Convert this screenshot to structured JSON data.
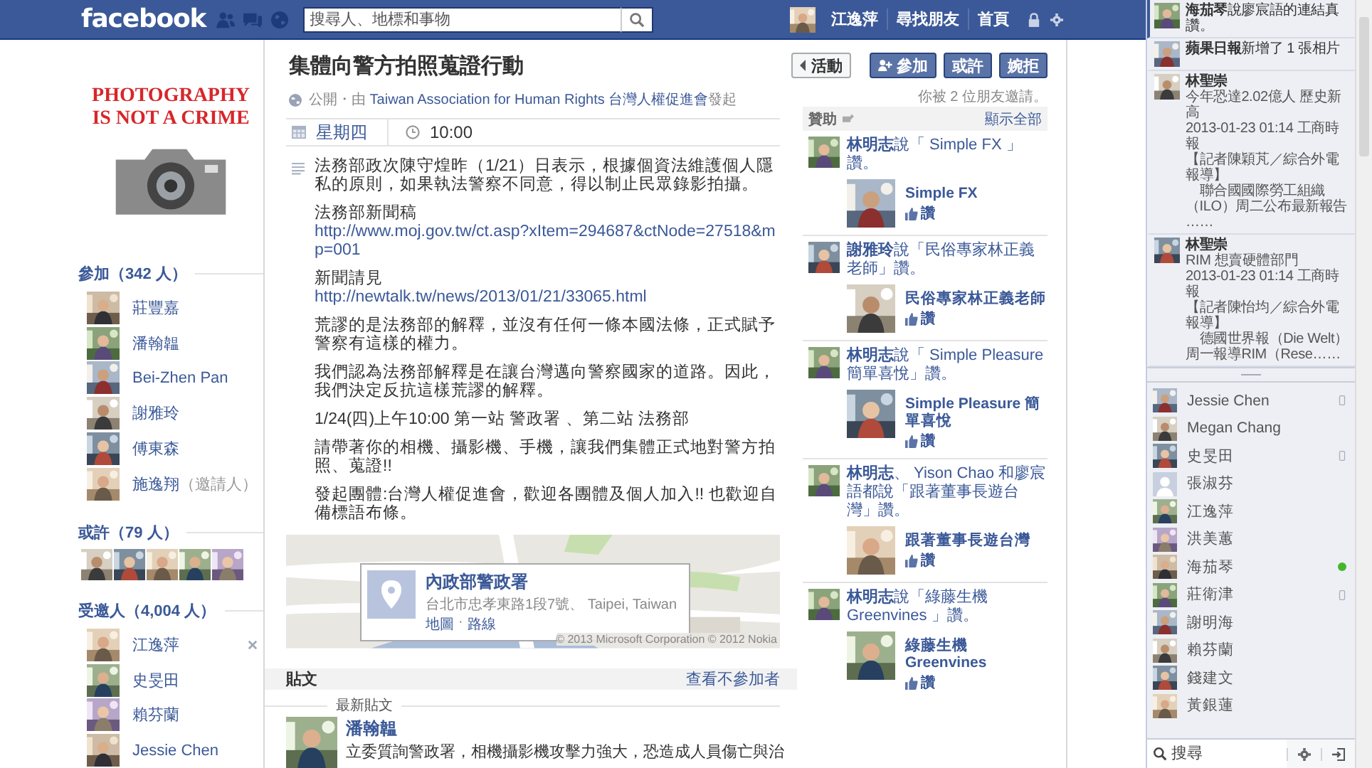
{
  "top_bar": {
    "logo": "facebook",
    "search": {
      "placeholder": "搜尋人、地標和事物"
    },
    "user": "江逸萍",
    "links": [
      "尋找朋友",
      "首頁"
    ]
  },
  "profile_image": {
    "lines": [
      "PHOTOGRAPHY",
      "IS NOT A CRIME"
    ]
  },
  "going": {
    "heading": "參加（342 人）",
    "people": [
      {
        "name": "莊豐嘉"
      },
      {
        "name": "潘翰韞"
      },
      {
        "name": "Bei-Zhen Pan"
      },
      {
        "name": "謝雅玲"
      },
      {
        "name": "傅東森"
      },
      {
        "name": "施逸翔",
        "note": "（邀請人）"
      }
    ]
  },
  "maybe": {
    "heading": "或許（79 人）"
  },
  "invited": {
    "heading": "受邀人（4,004 人）",
    "people": [
      {
        "name": "江逸萍",
        "removable": true
      },
      {
        "name": "史旻田",
        "removable": false
      },
      {
        "name": "賴芬蘭",
        "removable": false
      },
      {
        "name": "Jessie Chen",
        "removable": false
      }
    ]
  },
  "event": {
    "title": "集體向警方拍照蒐證行動",
    "byline_prefix": "公開・由 ",
    "host": "Taiwan Association for Human Rights 台灣人權促進會",
    "byline_suffix": "發起",
    "actions": [
      {
        "label": "活動",
        "kind": "back"
      },
      {
        "label": "參加",
        "kind": "join"
      },
      {
        "label": "或許",
        "kind": "plain"
      },
      {
        "label": "婉拒",
        "kind": "plain"
      }
    ],
    "invite_note": "你被 2 位朋友邀請。",
    "day": "星期四",
    "time": "10:00",
    "description": [
      {
        "text": "法務部政次陳守煌昨（1/21）日表示，根據個資法維護個人隱私的原則，如果執法警察不同意，得以制止民眾錄影拍攝。"
      },
      {
        "text": "法務部新聞稿",
        "link": "http://www.moj.gov.tw/ct.asp?xItem=294687&ctNode=27518&mp=001"
      },
      {
        "text": "新聞請見",
        "link": "http://newtalk.tw/news/2013/01/21/33065.html"
      },
      {
        "text": "荒謬的是法務部的解釋，並沒有任何一條本國法條，正式賦予警察有這樣的權力。"
      },
      {
        "text": "我們認為法務部解釋是在讓台灣邁向警察國家的道路。因此，我們決定反抗這樣荒謬的解釋。"
      },
      {
        "text": "1/24(四)上午10:00 第一站 警政署 、第二站 法務部"
      },
      {
        "text": "請帶著你的相機、攝影機、手機，讓我們集體正式地對警方拍照、蒐證!!"
      },
      {
        "text": "發起團體:台灣人權促進會，歡迎各團體及個人加入!! 也歡迎自備標語布條。"
      }
    ],
    "location": {
      "name": "內政部警政署",
      "address": "台北市忠孝東路1段7號、 Taipei, Taiwan",
      "links": [
        "地圖",
        "路線"
      ],
      "separator": "·",
      "copyright": "© 2013 Microsoft Corporation © 2012 Nokia"
    },
    "posts": {
      "heading": "貼文",
      "link": "查看不參加者",
      "divider_label": "最新貼文",
      "items": [
        {
          "author": "潘翰韞",
          "text": "立委質詢警政署，相機攝影機攻擊力強大，恐造成人員傷亡與治"
        }
      ]
    }
  },
  "sponsored": {
    "heading": "贊助",
    "link": "顯示全部",
    "items": [
      {
        "sentence": "**林明志**說「 Simple FX 」讚。",
        "page": "Simple FX",
        "like": "讚"
      },
      {
        "sentence": "**謝雅玲**說「民俗專家林正義老師」讚。",
        "page": "民俗專家林正義老師",
        "like": "讚"
      },
      {
        "sentence": "**林明志**說「 Simple Pleasure 簡單喜悅」讚。",
        "page": "Simple Pleasure 簡單喜悅",
        "like": "讚"
      },
      {
        "sentence": "**林明志**、 Yison Chao 和廖宸語都說「跟著董事長遊台灣」讚。",
        "page": "跟著董事長遊台灣",
        "like": "讚"
      },
      {
        "sentence": "**林明志**說「綠藤生機 Greenvines 」讚。",
        "page": "綠藤生機 Greenvines",
        "like": "讚"
      }
    ]
  },
  "ticker": [
    {
      "kind": "activity",
      "highlighted": true,
      "sentence": "**海茄琴**說廖宸語的連結真讚。"
    },
    {
      "kind": "activity",
      "highlighted": false,
      "sentence": "**蘋果日報**新增了 1 張相片"
    },
    {
      "kind": "story",
      "highlighted": false,
      "name": "林聖崇",
      "lines": [
        "今年恐達2.02億人 歷史新高",
        "2013-01-23 01:14 工商時報",
        "【記者陳穎芃／綜合外電報導】",
        "　聯合國國際勞工組織（ILO）周二公布最新報告",
        "……"
      ]
    },
    {
      "kind": "story",
      "highlighted": false,
      "name": "林聖崇",
      "lines": [
        "RIM 想賣硬體部門",
        "2013-01-23 01:14 工商時報",
        "【記者陳怡均／綜合外電報導】",
        "　德國世界報（Die Welt）周一報導RIM（Rese……"
      ]
    }
  ],
  "chat": {
    "friends": [
      {
        "name": "Jessie Chen",
        "mobile": true,
        "online": false,
        "default_avatar": false
      },
      {
        "name": "Megan Chang",
        "mobile": false,
        "online": false,
        "default_avatar": false
      },
      {
        "name": "史旻田",
        "mobile": true,
        "online": false,
        "default_avatar": false
      },
      {
        "name": "張淑芬",
        "mobile": false,
        "online": false,
        "default_avatar": true
      },
      {
        "name": "江逸萍",
        "mobile": false,
        "online": false,
        "default_avatar": false
      },
      {
        "name": "洪美蕙",
        "mobile": false,
        "online": false,
        "default_avatar": false
      },
      {
        "name": "海茄琴",
        "mobile": false,
        "online": true,
        "default_avatar": false
      },
      {
        "name": "莊衛津",
        "mobile": true,
        "online": false,
        "default_avatar": false
      },
      {
        "name": "謝明海",
        "mobile": false,
        "online": false,
        "default_avatar": false
      },
      {
        "name": "賴芬蘭",
        "mobile": false,
        "online": false,
        "default_avatar": false
      },
      {
        "name": "錢建文",
        "mobile": false,
        "online": false,
        "default_avatar": false
      },
      {
        "name": "黃銀蓮",
        "mobile": false,
        "online": false,
        "default_avatar": false
      }
    ],
    "search": {
      "placeholder": "搜尋"
    }
  }
}
